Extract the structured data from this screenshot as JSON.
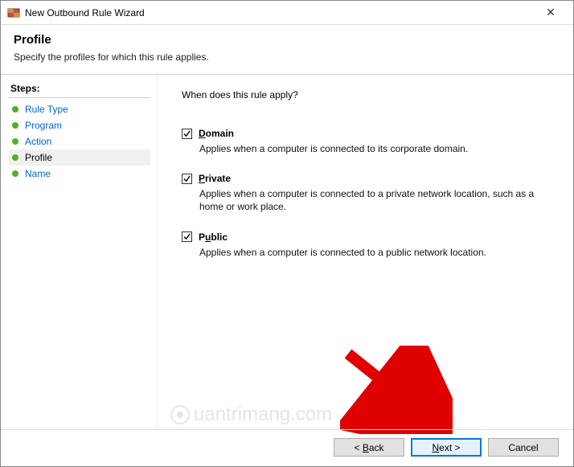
{
  "window": {
    "title": "New Outbound Rule Wizard"
  },
  "header": {
    "title": "Profile",
    "subtitle": "Specify the profiles for which this rule applies."
  },
  "sidebar": {
    "heading": "Steps:",
    "items": [
      {
        "label": "Rule Type",
        "current": false
      },
      {
        "label": "Program",
        "current": false
      },
      {
        "label": "Action",
        "current": false
      },
      {
        "label": "Profile",
        "current": true
      },
      {
        "label": "Name",
        "current": false
      }
    ]
  },
  "main": {
    "question": "When does this rule apply?",
    "options": [
      {
        "label": "Domain",
        "accel": "D",
        "checked": true,
        "desc": "Applies when a computer is connected to its corporate domain."
      },
      {
        "label": "Private",
        "accel": "P",
        "checked": true,
        "desc": "Applies when a computer is connected to a private network location, such as a home or work place."
      },
      {
        "label": "Public",
        "accel": "u",
        "checked": true,
        "desc": "Applies when a computer is connected to a public network location."
      }
    ]
  },
  "footer": {
    "back": "< Back",
    "next": "Next >",
    "cancel": "Cancel"
  },
  "watermark": "uantrimang.com"
}
